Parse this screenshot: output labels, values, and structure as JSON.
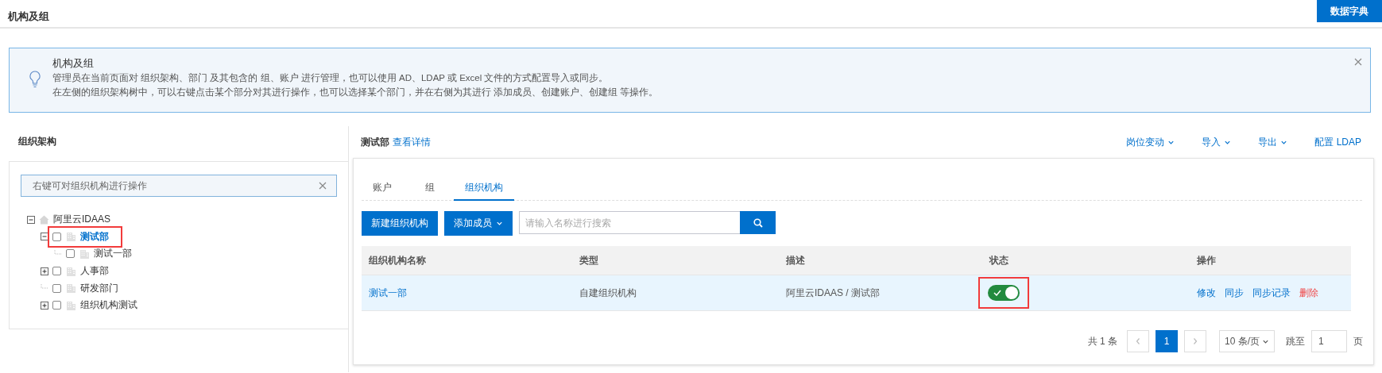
{
  "header": {
    "title": "机构及组",
    "dictionary_button": "数据字典"
  },
  "notice": {
    "title": "机构及组",
    "lines": [
      "管理员在当前页面对 组织架构、部门 及其包含的 组、账户 进行管理，也可以使用 AD、LDAP 或 Excel 文件的方式配置导入或同步。",
      "在左侧的组织架构树中，可以右键点击某个部分对其进行操作，也可以选择某个部门，并在右侧为其进行 添加成员、创建账户、创建组 等操作。"
    ]
  },
  "org_tree": {
    "title": "组织架构",
    "hint": "右键可对组织机构进行操作",
    "nodes": [
      {
        "label": "阿里云IDAAS",
        "kind": "root",
        "expanded": true,
        "selected": false,
        "children": [
          {
            "label": "测试部",
            "kind": "org",
            "expanded": true,
            "checked": false,
            "selected": true,
            "highlighted": true,
            "children": [
              {
                "label": "测试一部",
                "kind": "org",
                "checked": false,
                "selected": false,
                "highlighted": false
              }
            ]
          },
          {
            "label": "人事部",
            "kind": "org",
            "expanded": false,
            "checked": false,
            "selected": false,
            "highlighted": false
          },
          {
            "label": "研发部门",
            "kind": "org",
            "checked": false,
            "selected": false,
            "highlighted": false
          },
          {
            "label": "组织机构测试",
            "kind": "org",
            "expanded": false,
            "checked": false,
            "selected": false,
            "highlighted": false
          }
        ]
      }
    ]
  },
  "department": {
    "name": "测试部",
    "details_link": "查看详情",
    "menus": [
      {
        "label": "岗位变动",
        "dropdown": true
      },
      {
        "label": "导入",
        "dropdown": true
      },
      {
        "label": "导出",
        "dropdown": true
      },
      {
        "label": "配置 LDAP",
        "dropdown": false
      }
    ],
    "tabs": [
      {
        "label": "账户",
        "selected": false
      },
      {
        "label": "组",
        "selected": false
      },
      {
        "label": "组织机构",
        "selected": true
      }
    ],
    "toolbar": {
      "new_button": "新建组织机构",
      "add_member_button": "添加成员",
      "search": {
        "placeholder": "请输入名称进行搜索"
      }
    },
    "table": {
      "columns": [
        "组织机构名称",
        "类型",
        "描述",
        "状态",
        "操作"
      ],
      "rows": [
        {
          "name": "测试一部",
          "type": "自建组织机构",
          "description": "阿里云IDAAS / 测试部",
          "enabled": true,
          "highlighted": true,
          "actions": [
            {
              "label": "修改",
              "kind": "link"
            },
            {
              "label": "同步",
              "kind": "link"
            },
            {
              "label": "同步记录",
              "kind": "link"
            },
            {
              "label": "删除",
              "kind": "danger"
            }
          ]
        }
      ]
    },
    "pagination": {
      "total": "共 1 条",
      "pages": [
        {
          "label": "1",
          "selected": true
        }
      ],
      "page_size": "10 条/页",
      "jump_label": "跳至",
      "jump_value": "1",
      "page_unit": "页"
    }
  }
}
